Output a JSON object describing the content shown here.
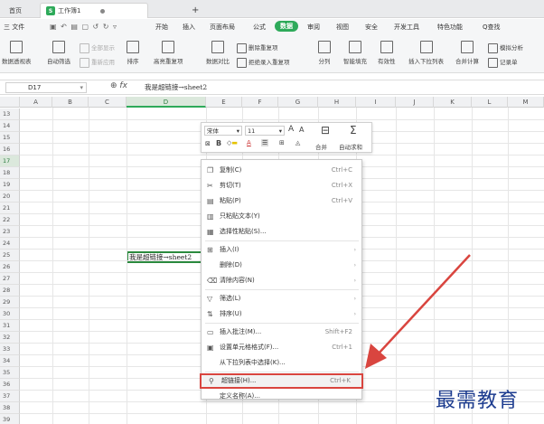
{
  "titlebar": {
    "tabs": [
      {
        "label": "首页"
      },
      {
        "label": "工作簿1",
        "logo": "S"
      },
      {
        "label": "+"
      }
    ]
  },
  "menubar": {
    "file": "三 文件",
    "items": [
      "开始",
      "插入",
      "页面布局",
      "公式",
      "数据",
      "审阅",
      "视图",
      "安全",
      "开发工具",
      "特色功能"
    ],
    "active": "数据",
    "search": "Q查找"
  },
  "ribbon": {
    "buttons": [
      "数据透视表",
      "自动筛选",
      "全部显示",
      "重新应用",
      "排序",
      "高亮重复项",
      "数据对比",
      "删除重复项",
      "拒绝录入重复项",
      "分列",
      "智能填充",
      "有效性",
      "插入下拉列表",
      "合并计算",
      "模拟分析",
      "记录单"
    ]
  },
  "formula_bar": {
    "cell_ref": "D17",
    "fx": "fx",
    "value": "我是超链接→sheet2"
  },
  "grid": {
    "columns": [
      "A",
      "B",
      "C",
      "D",
      "E",
      "F",
      "G",
      "H",
      "I",
      "J",
      "K",
      "L",
      "M"
    ],
    "selected_column": "D",
    "rows": [
      "13",
      "14",
      "15",
      "16",
      "17",
      "18",
      "19",
      "20",
      "21",
      "22",
      "23",
      "24",
      "25",
      "26",
      "27",
      "28",
      "29",
      "30",
      "31",
      "32",
      "33",
      "34",
      "35",
      "36",
      "37",
      "38",
      "39"
    ],
    "selected_row": "17",
    "cell_d17": "我是超链接→sheet2"
  },
  "mini_toolbar": {
    "font": "宋体",
    "size": "11",
    "merge": "合并",
    "autosum": "自动求和"
  },
  "context_menu": {
    "items": [
      {
        "icon": "copy-icon",
        "label": "复制(C)",
        "shortcut": "Ctrl+C"
      },
      {
        "icon": "cut-icon",
        "label": "剪切(T)",
        "shortcut": "Ctrl+X"
      },
      {
        "icon": "paste-icon",
        "label": "粘贴(P)",
        "shortcut": "Ctrl+V"
      },
      {
        "icon": "paste-text-icon",
        "label": "只粘贴文本(Y)",
        "shortcut": ""
      },
      {
        "icon": "paste-special-icon",
        "label": "选择性粘贴(S)...",
        "shortcut": ""
      },
      {
        "icon": "insert-icon",
        "label": "插入(I)",
        "shortcut": "",
        "submenu": true
      },
      {
        "icon": "",
        "label": "删除(D)",
        "shortcut": "",
        "submenu": true
      },
      {
        "icon": "clear-icon",
        "label": "清除内容(N)",
        "shortcut": "",
        "submenu": true
      },
      {
        "icon": "filter-icon",
        "label": "筛选(L)",
        "shortcut": "",
        "submenu": true
      },
      {
        "icon": "sort-icon",
        "label": "排序(U)",
        "shortcut": "",
        "submenu": true
      },
      {
        "icon": "comment-icon",
        "label": "插入批注(M)...",
        "shortcut": "Shift+F2"
      },
      {
        "icon": "format-cells-icon",
        "label": "设置单元格格式(F)...",
        "shortcut": "Ctrl+1"
      },
      {
        "icon": "",
        "label": "从下拉列表中选择(K)...",
        "shortcut": ""
      },
      {
        "icon": "link-icon",
        "label": "超链接(H)...",
        "shortcut": "Ctrl+K",
        "highlighted": true
      },
      {
        "icon": "",
        "label": "定义名称(A)...",
        "shortcut": ""
      }
    ]
  },
  "watermark": "最需教育",
  "colors": {
    "accent": "#2eaa5a",
    "highlight": "#d9453f",
    "watermark": "#1d3c8f"
  }
}
